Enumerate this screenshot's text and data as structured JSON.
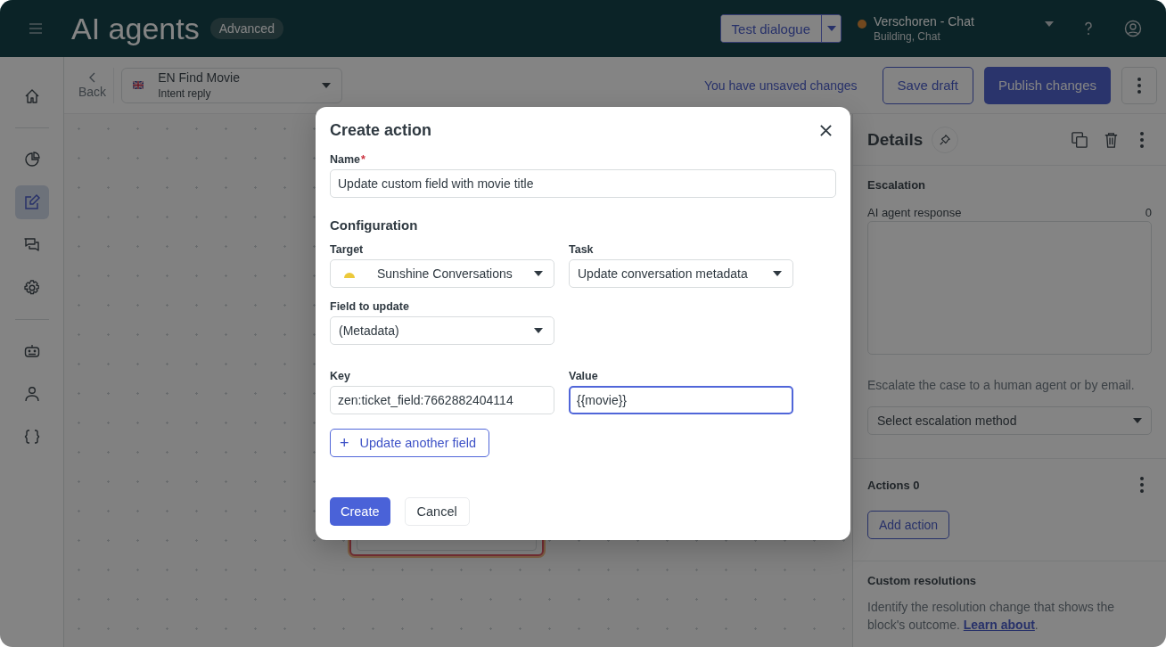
{
  "header": {
    "title": "AI agents",
    "badge": "Advanced",
    "test_button": "Test dialogue",
    "workspace": {
      "name": "Verschoren - Chat",
      "subtitle": "Building, Chat"
    }
  },
  "toolbar": {
    "back": "Back",
    "intent": {
      "title": "EN Find Movie",
      "subtitle": "Intent reply"
    },
    "unsaved": "You have unsaved changes",
    "save": "Save draft",
    "publish": "Publish changes"
  },
  "sidebar": {
    "items": [
      {
        "kind": "home",
        "selected": false
      },
      {
        "kind": "divider"
      },
      {
        "kind": "analytics",
        "selected": false
      },
      {
        "kind": "edit",
        "selected": true
      },
      {
        "kind": "chat",
        "selected": false
      },
      {
        "kind": "settings",
        "selected": false
      },
      {
        "kind": "divider"
      },
      {
        "kind": "bot",
        "selected": false
      },
      {
        "kind": "person",
        "selected": false
      },
      {
        "kind": "braces",
        "selected": false
      }
    ]
  },
  "canvas": {
    "node": {
      "kind": "dropdown"
    }
  },
  "details": {
    "title": "Details",
    "section": "Escalation",
    "response_label": "AI agent response",
    "response_count": "0",
    "hint": "Escalate the case to a human agent or by email.",
    "method_placeholder": "Select escalation method",
    "actions_title": "Actions 0",
    "add_action": "Add action",
    "resolutions_title": "Custom resolutions",
    "resolutions_text": "Identify the resolution change that shows the block's outcome.",
    "learn_link": "Learn about",
    "after_link": "."
  },
  "modal": {
    "title": "Create action",
    "name_label": "Name",
    "required_mark": "*",
    "name_value": "Update custom field with movie title",
    "section": "Configuration",
    "fields": [
      {
        "label": "Target",
        "value": "Sunshine Conversations",
        "kind": "select",
        "icon": true,
        "focused": false
      },
      {
        "label": "Task",
        "value": "Update conversation metadata",
        "kind": "select",
        "icon": false,
        "focused": false
      },
      {
        "label": "Field to update",
        "value": "(Metadata)",
        "kind": "select",
        "icon": false,
        "focused": false
      },
      {
        "kind": "break"
      },
      {
        "label": "Key",
        "value": "zen:ticket_field:7662882404114",
        "kind": "input",
        "icon": false,
        "focused": false
      },
      {
        "label": "Value",
        "value": "{{movie}}",
        "kind": "input",
        "icon": false,
        "focused": true
      }
    ],
    "add_field": "Update another field",
    "add_field_icon": "+",
    "create": "Create",
    "cancel": "Cancel"
  }
}
